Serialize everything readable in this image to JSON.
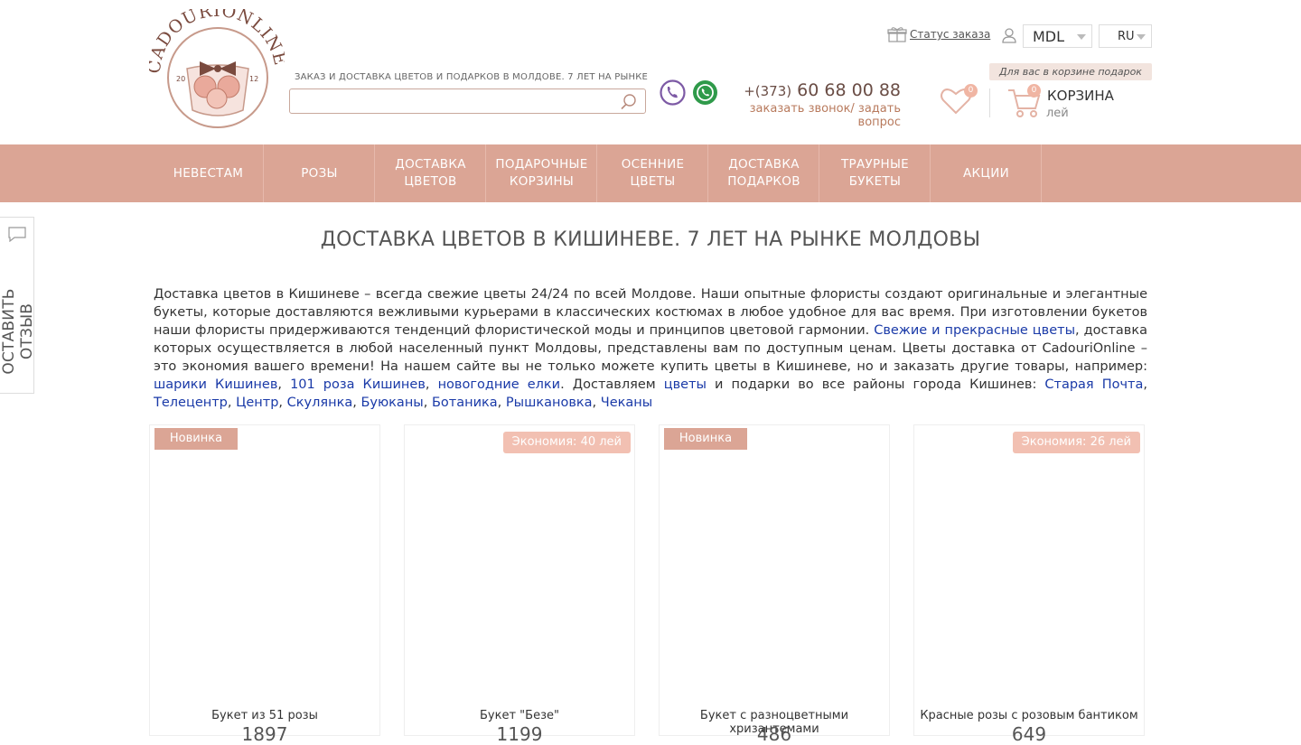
{
  "header": {
    "logo_text": "CADOURIONLINE",
    "logo_year_left": "20",
    "logo_year_right": "12",
    "tagline": "ЗАКАЗ И ДОСТАВКА ЦВЕТОВ И ПОДАРКОВ В МОЛДОВЕ. 7 ЛЕТ НА РЫНКЕ",
    "search_placeholder": "",
    "phone_prefix": "+(373)",
    "phone_number": "60 68 00 88",
    "callback_link": "заказать звонок/ задать вопрос",
    "order_status": "Статус заказа",
    "currency": "MDL",
    "language": "RU",
    "gift_note": "Для вас в корзине подарок",
    "wishlist_count": "0",
    "cart_count": "0",
    "cart_label": "КОРЗИНА",
    "cart_currency": "лей"
  },
  "nav": [
    {
      "line1": "НЕВЕСТАМ",
      "line2": ""
    },
    {
      "line1": "РОЗЫ",
      "line2": ""
    },
    {
      "line1": "ДОСТАВКА",
      "line2": "ЦВЕТОВ"
    },
    {
      "line1": "ПОДАРОЧНЫЕ",
      "line2": "КОРЗИНЫ"
    },
    {
      "line1": "ОСЕННИЕ",
      "line2": "ЦВЕТЫ"
    },
    {
      "line1": "ДОСТАВКА",
      "line2": "ПОДАРКОВ"
    },
    {
      "line1": "ТРАУРНЫЕ",
      "line2": "БУКЕТЫ"
    },
    {
      "line1": "АКЦИИ",
      "line2": ""
    }
  ],
  "feedback_tab": "ОСТАВИТЬ ОТЗЫВ",
  "page_title": "ДОСТАВКА ЦВЕТОВ В КИШИНЕВЕ. 7 ЛЕТ НА РЫНКЕ МОЛДОВЫ",
  "description": {
    "p1": "Доставка цветов в Кишиневе – всегда свежие цветы 24/24 по всей Молдове. Наши опытные флористы создают оригинальные и элегантные букеты, которые доставляются вежливыми курьерами в классических костюмах в любое удобное для вас время. При изготовлении букетов наши флористы придерживаются тенденций флористической моды и принципов цветовой гармонии. ",
    "link1": "Свежие и прекрасные цветы",
    "p2": ", доставка которых осуществляется в любой населенный пункт Молдовы, представлены вам по доступным ценам. Цветы доставка от CadouriOnline – это экономия вашего времени! На нашем сайте вы не только можете купить цветы в Кишиневе, но и заказать другие товары, например:  ",
    "link2": "шарики Кишинев",
    "sep1": ", ",
    "link3": "101 роза Кишинев",
    "sep2": ", ",
    "link4": "новогодние елки",
    "p3": ". Доставляем ",
    "link5": "цветы",
    "p4": " и подарки во все районы города Кишинев: ",
    "link6": "Старая Почта",
    "sep3": ", ",
    "link7": "Телецентр",
    "sep4": ", ",
    "link8": "Центр",
    "sep5": ", ",
    "link9": "Скулянка",
    "sep6": ", ",
    "link10": "Буюканы",
    "sep7": ", ",
    "link11": "Ботаника",
    "sep8": ", ",
    "link12": "Рышкановка",
    "sep9": ", ",
    "link13": "Чеканы"
  },
  "products": [
    {
      "badge": "Новинка",
      "name": "Букет из 51 розы",
      "price": "1897"
    },
    {
      "badge": "Экономия: 40 лей",
      "name": "Букет \"Безе\"",
      "price": "1199"
    },
    {
      "badge": "Новинка",
      "name": "Букет с разноцветными хризантемами",
      "price": "486"
    },
    {
      "badge": "Экономия: 26 лей",
      "name": "Красные розы с розовым бантиком",
      "price": "649"
    }
  ],
  "colors": {
    "accent": "#dba595",
    "link": "#1a3aa8",
    "viber": "#7d5aa5",
    "whatsapp": "#2f9a4a"
  }
}
